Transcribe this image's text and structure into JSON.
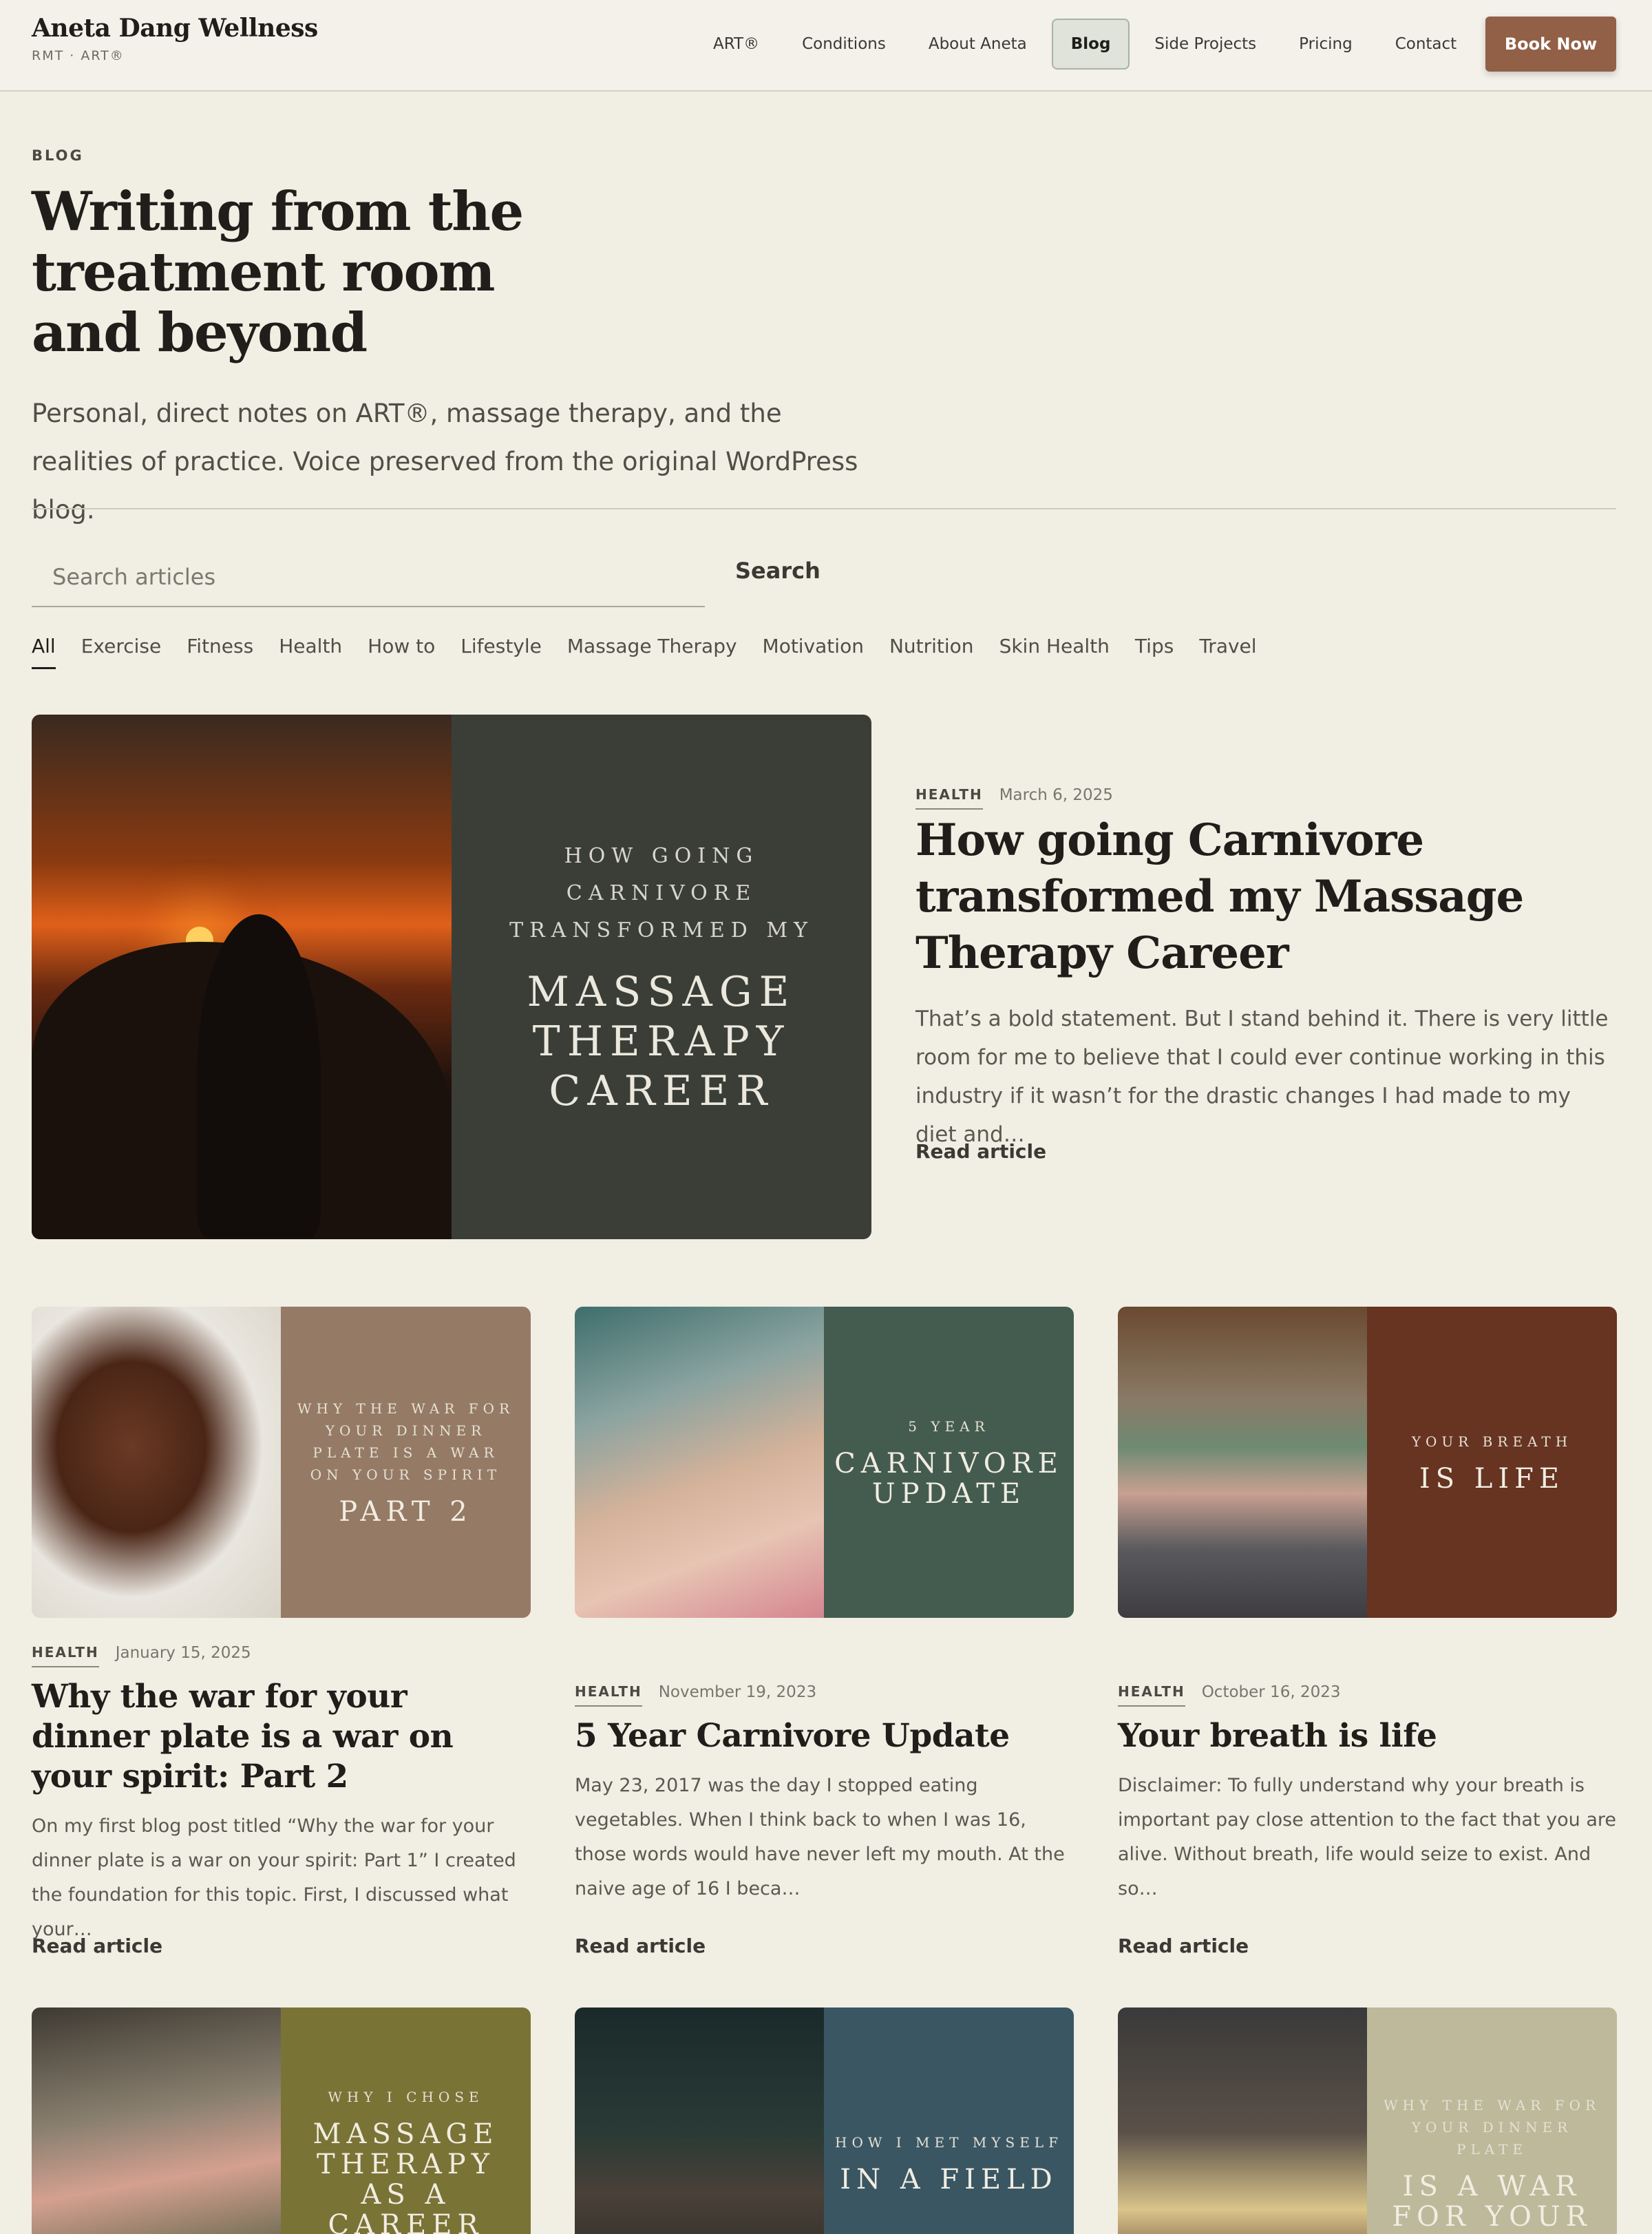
{
  "brand": {
    "name": "Aneta Dang Wellness",
    "sub": "RMT · ART®"
  },
  "nav": {
    "items": [
      "ART®",
      "Conditions",
      "About Aneta",
      "Blog",
      "Side Projects",
      "Pricing",
      "Contact"
    ],
    "active": "Blog",
    "cta": "Book Now"
  },
  "hero": {
    "eyebrow": "BLOG",
    "title": "Writing from the treatment room and beyond",
    "subtitle": "Personal, direct notes on ART®, massage therapy, and the realities of practice. Voice preserved from the original WordPress blog."
  },
  "search": {
    "placeholder": "Search articles",
    "value": "",
    "button": "Search"
  },
  "categories": {
    "items": [
      "All",
      "Exercise",
      "Fitness",
      "Health",
      "How to",
      "Lifestyle",
      "Massage Therapy",
      "Motivation",
      "Nutrition",
      "Skin Health",
      "Tips",
      "Travel"
    ],
    "active": "All"
  },
  "featured": {
    "image_text_small": "HOW GOING CARNIVORE TRANSFORMED MY",
    "image_text_big": "MASSAGE THERAPY CAREER",
    "image_panel_color": "#3b3e37",
    "tag": "HEALTH",
    "date": "March 6, 2025",
    "title": "How going Carnivore transformed my Massage Therapy Career",
    "excerpt": "That’s a bold statement. But I stand behind it. There is very little room for me to believe that I could ever continue working in this industry if it wasn’t for the drastic changes I had made to my diet and…",
    "read": "Read article"
  },
  "cards": [
    {
      "image_text_small": "WHY THE WAR FOR YOUR DINNER PLATE IS A WAR ON YOUR SPIRIT",
      "image_text_big": "PART 2",
      "panel_color": "#957a66",
      "photo": "steak-icon",
      "tag": "HEALTH",
      "date": "January 15, 2025",
      "title": "Why the war for your dinner plate is a war on your spirit: Part 2",
      "excerpt": "On my first blog post titled “Why the war for your dinner plate is a war on your spirit: Part 1” I created the foundation for this topic. First, I discussed what your…",
      "read": "Read article"
    },
    {
      "image_text_small": "5 YEAR",
      "image_text_big": "CARNIVORE UPDATE",
      "panel_color": "#445c4f",
      "photo": "smiling-woman-sunglasses",
      "tag": "HEALTH",
      "date": "November 19, 2023",
      "title": "5 Year Carnivore Update",
      "excerpt": "May 23, 2017 was the day I stopped eating vegetables. When I think back to when I was 16, those words would have never left my mouth. At the naive age of 16 I beca…",
      "read": "Read article"
    },
    {
      "image_text_small": "YOUR BREATH",
      "image_text_big": "IS LIFE",
      "panel_color": "#663421",
      "photo": "meditating-person",
      "tag": "HEALTH",
      "date": "October 16, 2023",
      "title": "Your breath is life",
      "excerpt": "Disclaimer: To fully understand why your breath is important pay close attention to the fact that you are alive. Without breath, life would seize to exist. And so…",
      "read": "Read article"
    },
    {
      "image_text_small": "WHY I CHOSE",
      "image_text_big": "MASSAGE THERAPY AS A CAREER",
      "panel_color": "#7a7336",
      "photo": "woman-studying"
    },
    {
      "image_text_small": "HOW I MET MYSELF",
      "image_text_big": "IN A FIELD",
      "panel_color": "#3a5663",
      "photo": "cabin-forest"
    },
    {
      "image_text_small": "WHY THE WAR FOR YOUR DINNER PLATE",
      "image_text_big": "IS A WAR FOR YOUR",
      "panel_color": "#bdb99a",
      "photo": "person-with-steak"
    }
  ]
}
